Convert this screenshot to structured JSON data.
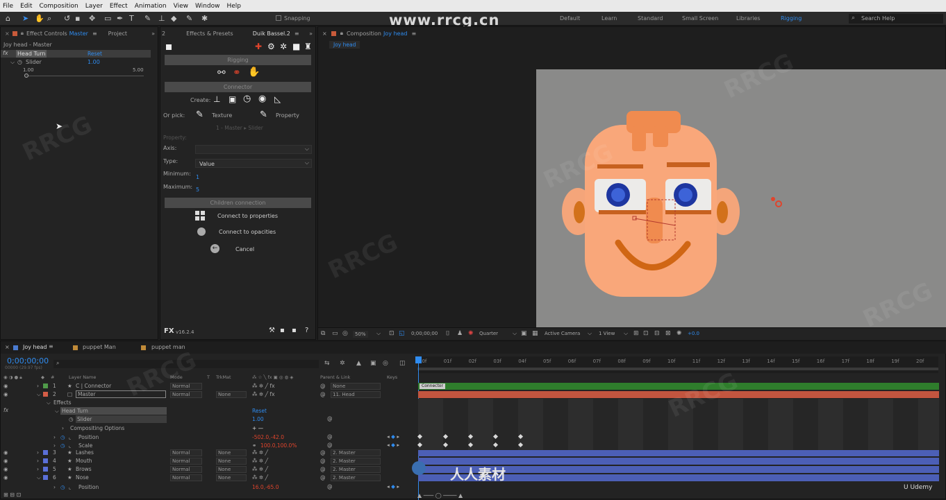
{
  "menubar": [
    "File",
    "Edit",
    "Composition",
    "Layer",
    "Effect",
    "Animation",
    "View",
    "Window",
    "Help"
  ],
  "toolbar": {
    "snapping": "Snapping",
    "workspaces": [
      "Default",
      "Learn",
      "Standard",
      "Small Screen",
      "Libraries",
      "Rigging"
    ],
    "search": "Search Help"
  },
  "watermark_url": "www.rrcg.cn",
  "left_panel": {
    "tab_prefix": "Effect Controls",
    "tab_layer": "Master",
    "tab_project": "Project",
    "subtitle": "Joy head - Master",
    "effect_name": "Head Turn",
    "reset": "Reset",
    "slider_label": "Slider",
    "slider_value": "1.00",
    "range_min": "1.00",
    "range_max": "5.00"
  },
  "duik": {
    "tab_effects": "Effects & Presets",
    "tab_duik": "Duik Bassel.2",
    "rigging": "Rigging",
    "connector": "Connector",
    "create": "Create:",
    "or_pick": "Or pick:",
    "texture": "Texture",
    "property_btn": "Property",
    "pick_info": "1 - Master ▸ Slider",
    "property_label": "Property:",
    "axis_label": "Axis:",
    "type_label": "Type:",
    "type_value": "Value",
    "minimum_label": "Minimum:",
    "minimum_value": "1",
    "maximum_label": "Maximum:",
    "maximum_value": "5",
    "children": "Children connection",
    "connect_props": "Connect to properties",
    "connect_opac": "Connect to opacities",
    "cancel": "Cancel",
    "version": "v16.2.4"
  },
  "comp": {
    "tab_prefix": "Composition",
    "tab_name": "Joy head",
    "crumb": "Joy head",
    "zoom": "50%",
    "timecode": "0;00;00;00",
    "resolution": "Quarter",
    "camera": "Active Camera",
    "view": "1 View",
    "exposure": "+0.0"
  },
  "timeline": {
    "tabs": [
      "Joy head",
      "puppet Man",
      "puppet man"
    ],
    "timecode": "0;00;00;00",
    "fps": "00000 (29.97 fps)",
    "headers": {
      "layer_name": "Layer Name",
      "mode": "Mode",
      "t": "T",
      "trkmat": "TrkMat",
      "parent": "Parent & Link",
      "keys": "Keys"
    },
    "ruler": [
      "00f",
      "01f",
      "02f",
      "03f",
      "04f",
      "05f",
      "06f",
      "07f",
      "08f",
      "09f",
      "10f",
      "11f",
      "12f",
      "13f",
      "14f",
      "15f",
      "16f",
      "17f",
      "18f",
      "19f",
      "20f"
    ],
    "layers": [
      {
        "num": "1",
        "name": "C | Connector",
        "mode": "Normal",
        "trk": "",
        "parent": "None",
        "color": "#4f9a49",
        "bar": "#2f7d2c",
        "barlabel": "Connector"
      },
      {
        "num": "2",
        "name": "Master",
        "mode": "Normal",
        "trk": "None",
        "parent": "11. Head",
        "color": "#d45d47",
        "bar": "#c2553f",
        "barlabel": ""
      },
      {
        "num": "3",
        "name": "Lashes",
        "mode": "Normal",
        "trk": "None",
        "parent": "2. Master",
        "color": "#5a6fd8",
        "bar": "#4c5fb6",
        "barlabel": ""
      },
      {
        "num": "4",
        "name": "Mouth",
        "mode": "Normal",
        "trk": "None",
        "parent": "2. Master",
        "color": "#5a6fd8",
        "bar": "#4c5fb6",
        "barlabel": ""
      },
      {
        "num": "5",
        "name": "Brows",
        "mode": "Normal",
        "trk": "None",
        "parent": "2. Master",
        "color": "#5a6fd8",
        "bar": "#4c5fb6",
        "barlabel": ""
      },
      {
        "num": "6",
        "name": "Nose",
        "mode": "Normal",
        "trk": "None",
        "parent": "2. Master",
        "color": "#5a6fd8",
        "bar": "#4c5fb6",
        "barlabel": ""
      }
    ],
    "sub": {
      "effects": "Effects",
      "head_turn": "Head Turn",
      "reset": "Reset",
      "slider": "Slider",
      "slider_val": "1.00",
      "compositing": "Compositing Options",
      "compositing_val": "+ —",
      "position": "Position",
      "position_val": "-502.0,-42.0",
      "scale": "Scale",
      "scale_val": "100.0,100.0%",
      "nose_position": "Position",
      "nose_position_val": "16.0,-65.0"
    }
  },
  "brand": "人人素材",
  "udemy": "Udemy"
}
